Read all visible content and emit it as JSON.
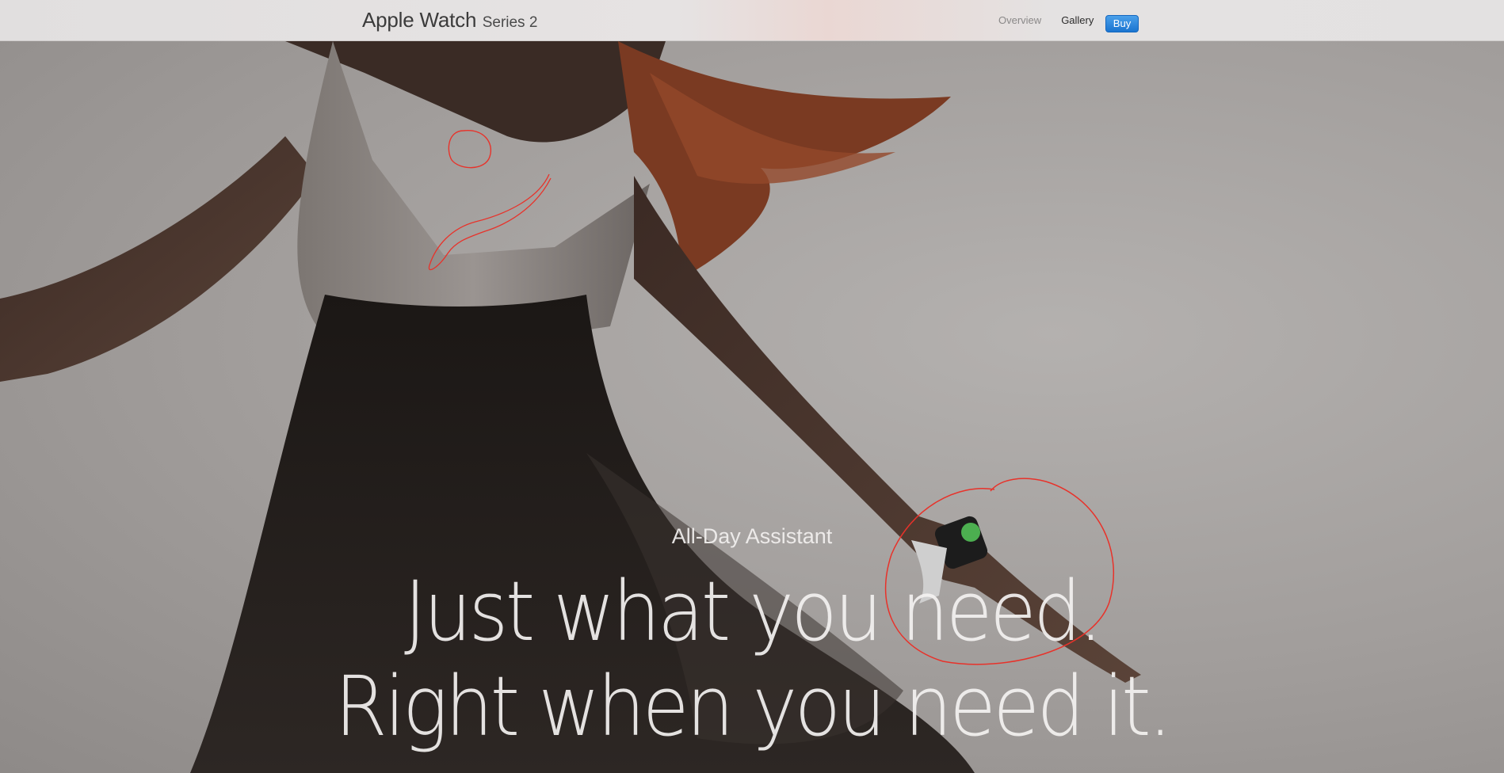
{
  "nav": {
    "brand_name": "Apple Watch",
    "brand_series": "Series 2",
    "links": [
      {
        "label": "Overview"
      },
      {
        "label": "Gallery"
      }
    ],
    "buy_label": "Buy"
  },
  "hero": {
    "eyebrow": "All-Day Assistant",
    "headline_line1": "Just what you need.",
    "headline_line2": "Right when you need it."
  },
  "colors": {
    "buy_button": "#1a74d0",
    "annotation": "#e8322a",
    "hero_background": "#a39f9d"
  }
}
